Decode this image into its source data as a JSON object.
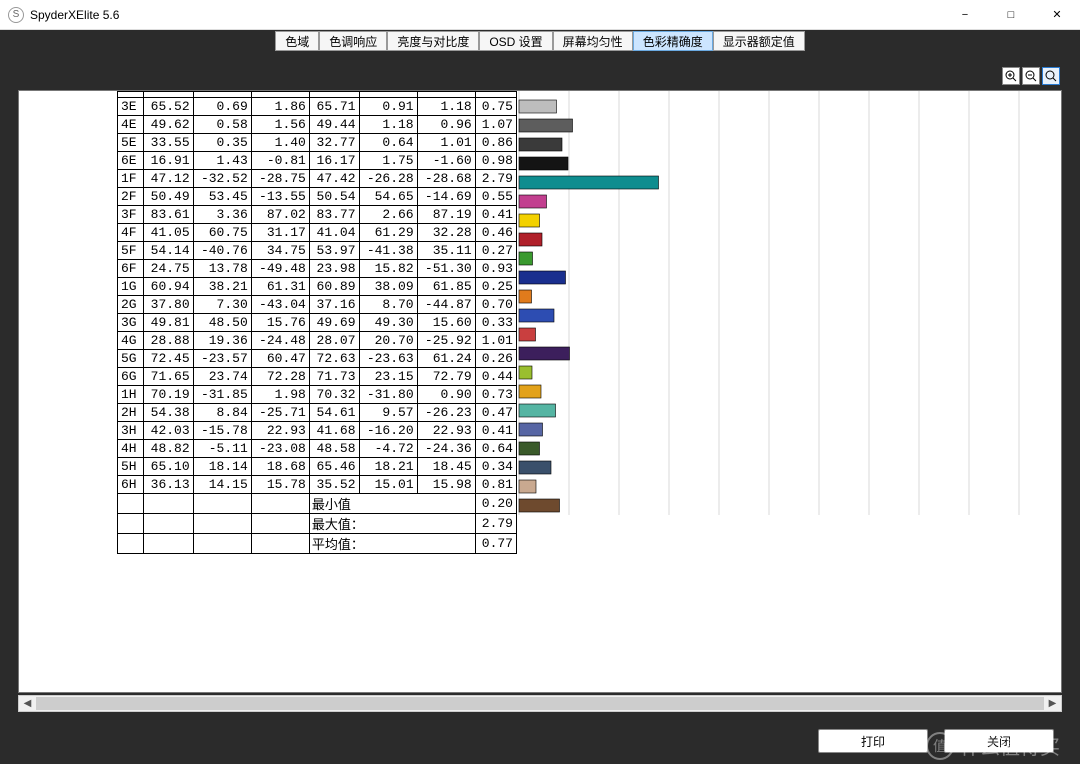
{
  "app": {
    "title": "SpyderXElite 5.6"
  },
  "tabs": {
    "items": [
      "色域",
      "色调响应",
      "亮度与对比度",
      "OSD 设置",
      "屏幕均匀性",
      "色彩精确度",
      "显示器额定值"
    ],
    "activeIndex": 5
  },
  "footer": {
    "print": "打印",
    "close": "关闭"
  },
  "watermark": {
    "icon": "值",
    "text": "什么值得买"
  },
  "summary": {
    "minLabel": "最小值",
    "minVal": "0.20",
    "maxLabel": "最大值：",
    "maxVal": "2.79",
    "avgLabel": "平均值：",
    "avgVal": "0.77"
  },
  "chart_data": {
    "type": "bar",
    "orientation": "horizontal",
    "xlim": [
      0,
      5
    ],
    "gridStep": 0.5,
    "series_cols": [
      "c1",
      "c2",
      "c3",
      "c4",
      "c5",
      "c6",
      "delta"
    ],
    "rows": [
      {
        "label": "3E",
        "c1": "65.52",
        "c2": "0.69",
        "c3": "1.86",
        "c4": "65.71",
        "c5": "0.91",
        "c6": "1.18",
        "delta": "0.75",
        "bar": 0.75,
        "color": "#bdbdbd"
      },
      {
        "label": "4E",
        "c1": "49.62",
        "c2": "0.58",
        "c3": "1.56",
        "c4": "49.44",
        "c5": "1.18",
        "c6": "0.96",
        "delta": "1.07",
        "bar": 1.07,
        "color": "#5d5d5d"
      },
      {
        "label": "5E",
        "c1": "33.55",
        "c2": "0.35",
        "c3": "1.40",
        "c4": "32.77",
        "c5": "0.64",
        "c6": "1.01",
        "delta": "0.86",
        "bar": 0.86,
        "color": "#3a3a3a"
      },
      {
        "label": "6E",
        "c1": "16.91",
        "c2": "1.43",
        "c3": "-0.81",
        "c4": "16.17",
        "c5": "1.75",
        "c6": "-1.60",
        "delta": "0.98",
        "bar": 0.98,
        "color": "#141414"
      },
      {
        "label": "1F",
        "c1": "47.12",
        "c2": "-32.52",
        "c3": "-28.75",
        "c4": "47.42",
        "c5": "-26.28",
        "c6": "-28.68",
        "delta": "2.79",
        "bar": 2.79,
        "color": "#0e8d8f"
      },
      {
        "label": "2F",
        "c1": "50.49",
        "c2": "53.45",
        "c3": "-13.55",
        "c4": "50.54",
        "c5": "54.65",
        "c6": "-14.69",
        "delta": "0.55",
        "bar": 0.55,
        "color": "#c23f8f"
      },
      {
        "label": "3F",
        "c1": "83.61",
        "c2": "3.36",
        "c3": "87.02",
        "c4": "83.77",
        "c5": "2.66",
        "c6": "87.19",
        "delta": "0.41",
        "bar": 0.41,
        "color": "#f3d100"
      },
      {
        "label": "4F",
        "c1": "41.05",
        "c2": "60.75",
        "c3": "31.17",
        "c4": "41.04",
        "c5": "61.29",
        "c6": "32.28",
        "delta": "0.46",
        "bar": 0.46,
        "color": "#b0202a"
      },
      {
        "label": "5F",
        "c1": "54.14",
        "c2": "-40.76",
        "c3": "34.75",
        "c4": "53.97",
        "c5": "-41.38",
        "c6": "35.11",
        "delta": "0.27",
        "bar": 0.27,
        "color": "#3a9a2f"
      },
      {
        "label": "6F",
        "c1": "24.75",
        "c2": "13.78",
        "c3": "-49.48",
        "c4": "23.98",
        "c5": "15.82",
        "c6": "-51.30",
        "delta": "0.93",
        "bar": 0.93,
        "color": "#1a2f8e"
      },
      {
        "label": "1G",
        "c1": "60.94",
        "c2": "38.21",
        "c3": "61.31",
        "c4": "60.89",
        "c5": "38.09",
        "c6": "61.85",
        "delta": "0.25",
        "bar": 0.25,
        "color": "#e07b1c"
      },
      {
        "label": "2G",
        "c1": "37.80",
        "c2": "7.30",
        "c3": "-43.04",
        "c4": "37.16",
        "c5": "8.70",
        "c6": "-44.87",
        "delta": "0.70",
        "bar": 0.7,
        "color": "#2d4db2"
      },
      {
        "label": "3G",
        "c1": "49.81",
        "c2": "48.50",
        "c3": "15.76",
        "c4": "49.69",
        "c5": "49.30",
        "c6": "15.60",
        "delta": "0.33",
        "bar": 0.33,
        "color": "#c93f3f"
      },
      {
        "label": "4G",
        "c1": "28.88",
        "c2": "19.36",
        "c3": "-24.48",
        "c4": "28.07",
        "c5": "20.70",
        "c6": "-25.92",
        "delta": "1.01",
        "bar": 1.01,
        "color": "#3c1f5c"
      },
      {
        "label": "5G",
        "c1": "72.45",
        "c2": "-23.57",
        "c3": "60.47",
        "c4": "72.63",
        "c5": "-23.63",
        "c6": "61.24",
        "delta": "0.26",
        "bar": 0.26,
        "color": "#9abf2f"
      },
      {
        "label": "6G",
        "c1": "71.65",
        "c2": "23.74",
        "c3": "72.28",
        "c4": "71.73",
        "c5": "23.15",
        "c6": "72.79",
        "delta": "0.44",
        "bar": 0.44,
        "color": "#e2a21a"
      },
      {
        "label": "1H",
        "c1": "70.19",
        "c2": "-31.85",
        "c3": "1.98",
        "c4": "70.32",
        "c5": "-31.80",
        "c6": "0.90",
        "delta": "0.73",
        "bar": 0.73,
        "color": "#55b5a3"
      },
      {
        "label": "2H",
        "c1": "54.38",
        "c2": "8.84",
        "c3": "-25.71",
        "c4": "54.61",
        "c5": "9.57",
        "c6": "-26.23",
        "delta": "0.47",
        "bar": 0.47,
        "color": "#5766a4"
      },
      {
        "label": "3H",
        "c1": "42.03",
        "c2": "-15.78",
        "c3": "22.93",
        "c4": "41.68",
        "c5": "-16.20",
        "c6": "22.93",
        "delta": "0.41",
        "bar": 0.41,
        "color": "#3a5a2a"
      },
      {
        "label": "4H",
        "c1": "48.82",
        "c2": "-5.11",
        "c3": "-23.08",
        "c4": "48.58",
        "c5": "-4.72",
        "c6": "-24.36",
        "delta": "0.64",
        "bar": 0.64,
        "color": "#3a506b"
      },
      {
        "label": "5H",
        "c1": "65.10",
        "c2": "18.14",
        "c3": "18.68",
        "c4": "65.46",
        "c5": "18.21",
        "c6": "18.45",
        "delta": "0.34",
        "bar": 0.34,
        "color": "#c9a990"
      },
      {
        "label": "6H",
        "c1": "36.13",
        "c2": "14.15",
        "c3": "15.78",
        "c4": "35.52",
        "c5": "15.01",
        "c6": "15.98",
        "delta": "0.81",
        "bar": 0.81,
        "color": "#6e4a2e"
      }
    ]
  }
}
